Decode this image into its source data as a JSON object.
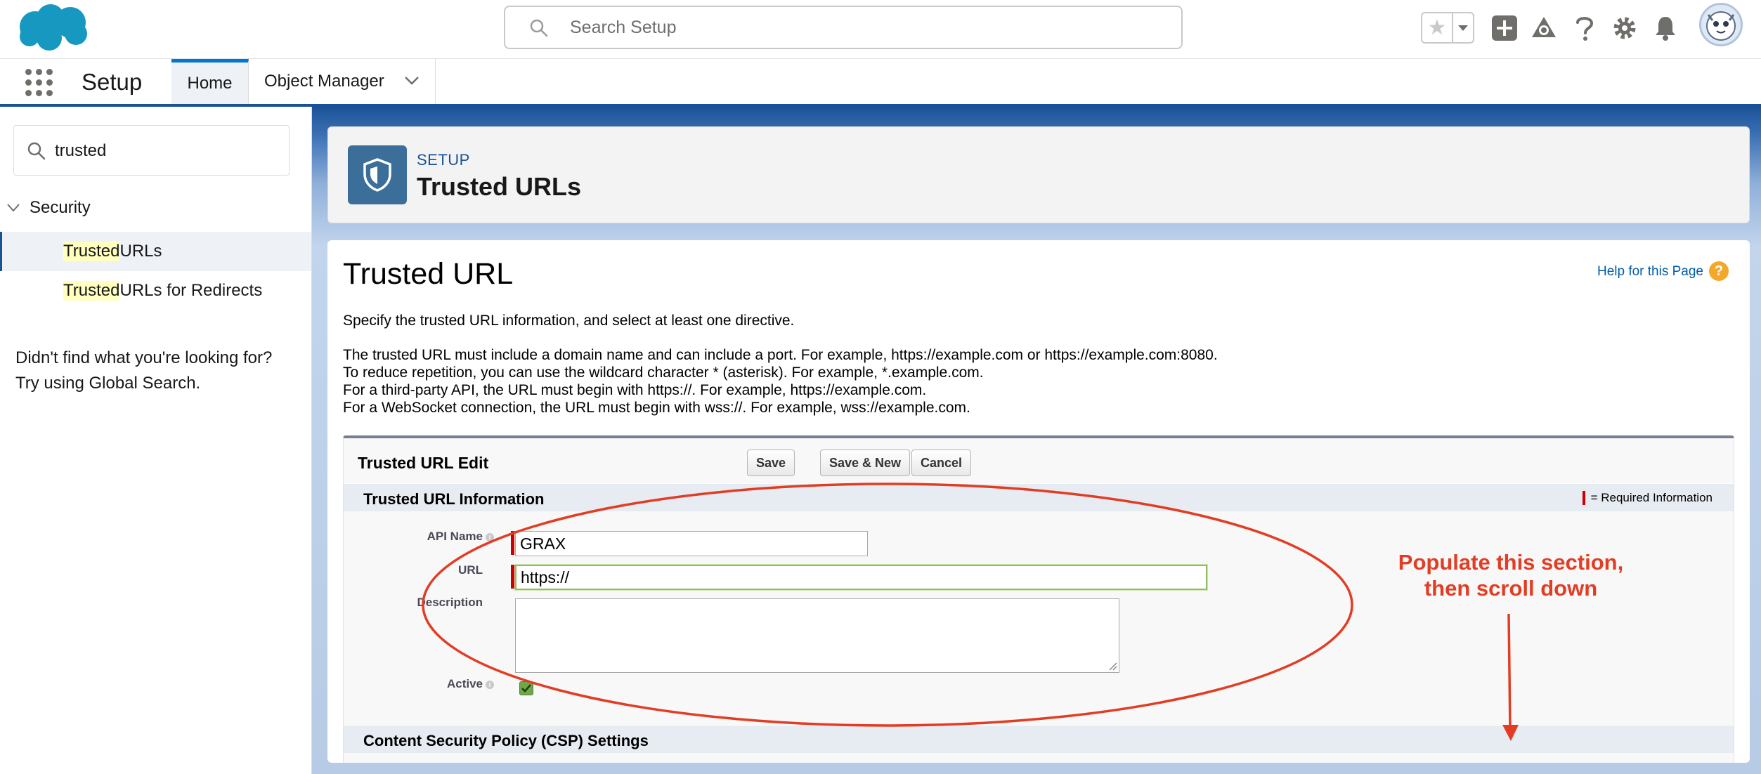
{
  "header": {
    "search_placeholder": "Search Setup",
    "icons": [
      "salesforce-cloud-logo",
      "search-icon",
      "favorites-star-icon",
      "favorites-dropdown-icon",
      "add-icon",
      "trailhead-icon",
      "help-icon",
      "gear-icon",
      "bell-icon",
      "user-avatar"
    ]
  },
  "nav": {
    "app_name": "Setup",
    "tabs": [
      {
        "label": "Home",
        "active": true
      },
      {
        "label": "Object Manager",
        "has_menu": true
      }
    ]
  },
  "sidebar": {
    "quickfind_value": "trusted",
    "group_label": "Security",
    "items": [
      {
        "highlight": "Trusted",
        "rest": " URLs",
        "selected": true
      },
      {
        "highlight": "Trusted",
        "rest": " URLs for Redirects",
        "selected": false
      }
    ],
    "not_found_line1": "Didn't find what you're looking for?",
    "not_found_line2": "Try using Global Search."
  },
  "page_header": {
    "eyebrow": "SETUP",
    "title": "Trusted URLs"
  },
  "content": {
    "title": "Trusted URL",
    "help_link": "Help for this Page",
    "intro": "Specify the trusted URL information, and select at least one directive.",
    "lines": [
      "The trusted URL must include a domain name and can include a port. For example, https://example.com or https://example.com:8080.",
      "To reduce repetition, you can use the wildcard character * (asterisk). For example, *.example.com.",
      "For a third-party API, the URL must begin with https://. For example, https://example.com.",
      "For a WebSocket connection, the URL must begin with wss://. For example, wss://example.com."
    ]
  },
  "edit": {
    "title": "Trusted URL Edit",
    "buttons": {
      "save": "Save",
      "save_new": "Save & New",
      "cancel": "Cancel"
    },
    "section_info": "Trusted URL Information",
    "required_legend": "= Required Information",
    "fields": {
      "api_name_label": "API Name",
      "api_name_value": "GRAX",
      "url_label": "URL",
      "url_value": "https://",
      "description_label": "Description",
      "description_value": "",
      "active_label": "Active",
      "active_checked": true
    },
    "section_csp": "Content Security Policy (CSP) Settings"
  },
  "annotation": {
    "line1": "Populate this section,",
    "line2": "then scroll down",
    "color": "#e23d24"
  },
  "colors": {
    "brand_blue": "#1b5297",
    "salesforce_blue": "#1798c1",
    "required_red": "#cc0000",
    "annotation_red": "#e23d24"
  }
}
